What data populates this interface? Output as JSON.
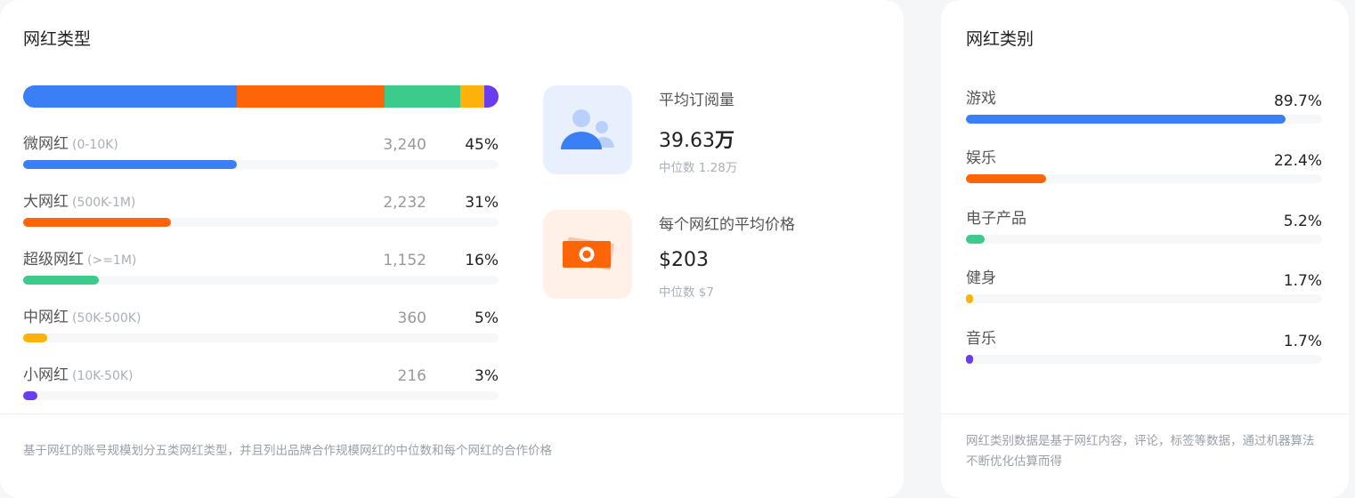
{
  "types": {
    "title": "网红类型",
    "rows": [
      {
        "name": "微网红",
        "range": "(0-10K)",
        "count": "3,240",
        "percent": "45%",
        "fraction": 0.45,
        "color": "#3a7ff6"
      },
      {
        "name": "大网红",
        "range": "(500K-1M)",
        "count": "2,232",
        "percent": "31%",
        "fraction": 0.31,
        "color": "#fd6508"
      },
      {
        "name": "超级网红",
        "range": "(>=1M)",
        "count": "1,152",
        "percent": "16%",
        "fraction": 0.16,
        "color": "#3ccb8a"
      },
      {
        "name": "中网红",
        "range": "(50K-500K)",
        "count": "360",
        "percent": "5%",
        "fraction": 0.05,
        "color": "#fdb20b"
      },
      {
        "name": "小网红",
        "range": "(10K-50K)",
        "count": "216",
        "percent": "3%",
        "fraction": 0.03,
        "color": "#6a3df0"
      }
    ],
    "footnote": "基于网红的账号规模划分五类网红类型，并且列出品牌合作规模网红的中位数和每个网红的合作价格"
  },
  "stats": [
    {
      "title": "平均订阅量",
      "value": "39.63",
      "unit": "万",
      "median": "中位数 1.28万",
      "icon": "users-icon",
      "icon_bg": "#e8f0fe",
      "icon_color": "#3a7ff6"
    },
    {
      "title": "每个网红的平均价格",
      "value": "$203",
      "unit": "",
      "median": "中位数 $7",
      "icon": "money-icon",
      "icon_bg": "#fff0e8",
      "icon_color": "#fd6508"
    }
  ],
  "categories": {
    "title": "网红类别",
    "rows": [
      {
        "name": "游戏",
        "percent": "89.7%",
        "fraction": 0.897,
        "color": "#3a7ff6"
      },
      {
        "name": "娱乐",
        "percent": "22.4%",
        "fraction": 0.224,
        "color": "#fd6508"
      },
      {
        "name": "电子产品",
        "percent": "5.2%",
        "fraction": 0.052,
        "color": "#3ccb8a"
      },
      {
        "name": "健身",
        "percent": "1.7%",
        "fraction": 0.017,
        "color": "#fdb20b"
      },
      {
        "name": "音乐",
        "percent": "1.7%",
        "fraction": 0.017,
        "color": "#6a3df0"
      }
    ],
    "footnote": "网红类别数据是基于网红内容，评论，标签等数据，通过机器算法不断优化估算而得"
  }
}
